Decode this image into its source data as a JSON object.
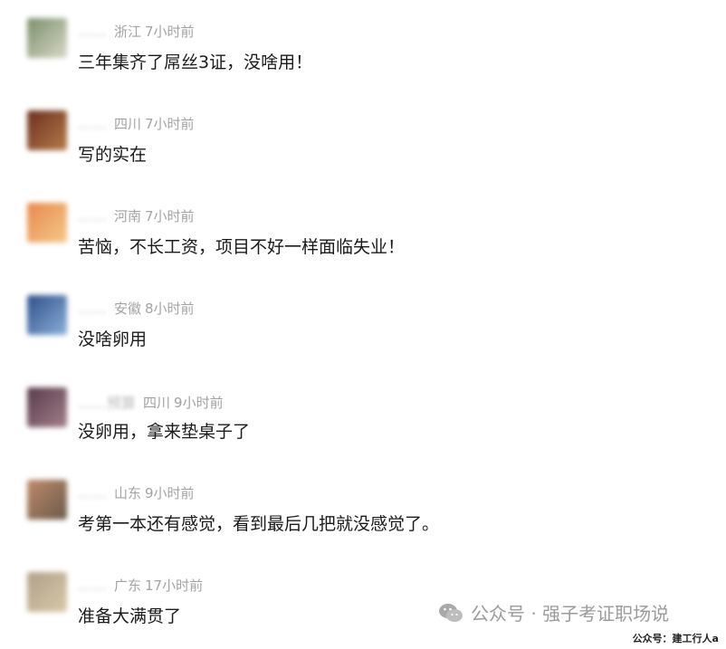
{
  "comments": [
    {
      "name": "……",
      "region": "浙江",
      "time": "7小时前",
      "text": "三年集齐了屌丝3证，没啥用！",
      "avatar_colors": [
        "#7a8f6a",
        "#d8d8c8"
      ]
    },
    {
      "name": "……",
      "region": "四川",
      "time": "7小时前",
      "text": "写的实在",
      "avatar_colors": [
        "#6b2f1f",
        "#b57a4a"
      ]
    },
    {
      "name": "……",
      "region": "河南",
      "time": "7小时前",
      "text": "苦恼，不长工资，项目不好一样面临失业！",
      "avatar_colors": [
        "#e8894a",
        "#f3c98a"
      ]
    },
    {
      "name": "……",
      "region": "安徽",
      "time": "8小时前",
      "text": "没啥卵用",
      "avatar_colors": [
        "#2f4f8a",
        "#8ab0d8"
      ]
    },
    {
      "name": "……预算",
      "region": "四川",
      "time": "9小时前",
      "text": "没卵用，拿来垫桌子了",
      "avatar_colors": [
        "#5a3a4a",
        "#a0808a"
      ]
    },
    {
      "name": "……",
      "region": "山东",
      "time": "9小时前",
      "text": "考第一本还有感觉，看到最后几把就没感觉了。",
      "avatar_colors": [
        "#c08a6a",
        "#6a5a4a"
      ]
    },
    {
      "name": "……",
      "region": "广东",
      "time": "17小时前",
      "text": "准备大满贯了",
      "avatar_colors": [
        "#b0a08a",
        "#d8c8a8"
      ]
    }
  ],
  "watermark": {
    "label": "公众号 · 强子考证职场说",
    "icon": "wechat-icon"
  },
  "footer_credit": "公众号：建工行人a"
}
